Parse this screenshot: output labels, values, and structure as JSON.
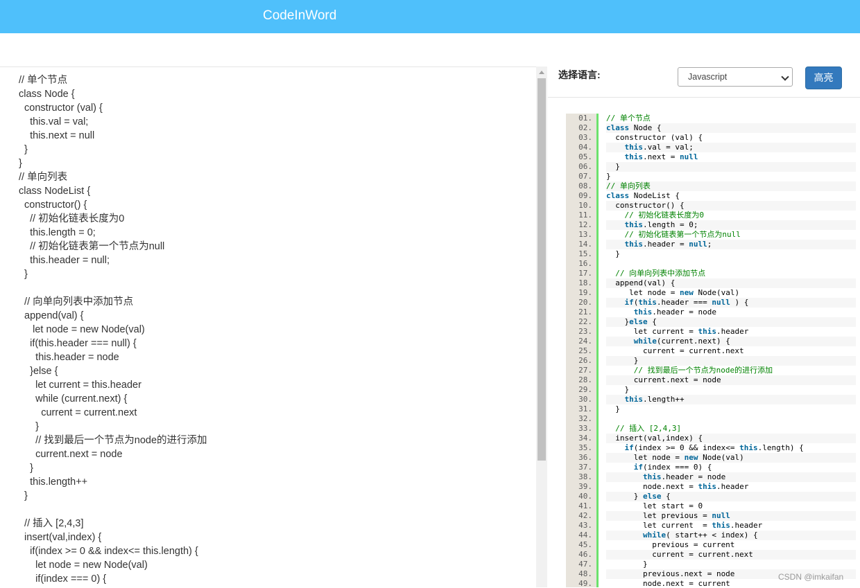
{
  "header": {
    "title": "CodeInWord"
  },
  "left_editor": {
    "lines": [
      "// 单个节点",
      "class Node {",
      "  constructor (val) {",
      "    this.val = val;",
      "    this.next = null",
      "  }",
      "}",
      "// 单向列表",
      "class NodeList {",
      "  constructor() {",
      "    // 初始化链表长度为0",
      "    this.length = 0;",
      "    // 初始化链表第一个节点为null",
      "    this.header = null;",
      "  }",
      "",
      "  // 向单向列表中添加节点",
      "  append(val) {",
      "     let node = new Node(val)",
      "    if(this.header === null) {",
      "      this.header = node",
      "    }else {",
      "      let current = this.header",
      "      while (current.next) {",
      "        current = current.next",
      "      }",
      "      // 找到最后一个节点为node的进行添加",
      "      current.next = node",
      "    }",
      "    this.length++",
      "  }",
      "",
      "  // 插入 [2,4,3]",
      "  insert(val,index) {",
      "    if(index >= 0 && index<= this.length) {",
      "      let node = new Node(val)",
      "      if(index === 0) {"
    ]
  },
  "controls": {
    "language_label": "选择语言:",
    "language_selected": "Javascript",
    "highlight_button": "高亮"
  },
  "highlighted": {
    "lines": [
      {
        "n": "01.",
        "t": [
          [
            "cm",
            "// 单个节点"
          ]
        ]
      },
      {
        "n": "02.",
        "t": [
          [
            "kw",
            "class"
          ],
          [
            "",
            "Node {"
          ]
        ]
      },
      {
        "n": "03.",
        "t": [
          [
            "",
            "  constructor (val) {"
          ]
        ]
      },
      {
        "n": "04.",
        "t": [
          [
            "",
            "    "
          ],
          [
            "kw",
            "this"
          ],
          [
            "",
            ".val = val;"
          ]
        ]
      },
      {
        "n": "05.",
        "t": [
          [
            "",
            "    "
          ],
          [
            "kw",
            "this"
          ],
          [
            "",
            ".next = "
          ],
          [
            "kw",
            "null"
          ]
        ]
      },
      {
        "n": "06.",
        "t": [
          [
            "",
            "  }"
          ]
        ]
      },
      {
        "n": "07.",
        "t": [
          [
            "",
            "}"
          ]
        ]
      },
      {
        "n": "08.",
        "t": [
          [
            "cm",
            "// 单向列表"
          ]
        ]
      },
      {
        "n": "09.",
        "t": [
          [
            "kw",
            "class"
          ],
          [
            "",
            "NodeList {"
          ]
        ]
      },
      {
        "n": "10.",
        "t": [
          [
            "",
            "  constructor() {"
          ]
        ]
      },
      {
        "n": "11.",
        "t": [
          [
            "",
            "    "
          ],
          [
            "cm",
            "// 初始化链表长度为0"
          ]
        ]
      },
      {
        "n": "12.",
        "t": [
          [
            "",
            "    "
          ],
          [
            "kw",
            "this"
          ],
          [
            "",
            ".length = 0;"
          ]
        ]
      },
      {
        "n": "13.",
        "t": [
          [
            "",
            "    "
          ],
          [
            "cm",
            "// 初始化链表第一个节点为null"
          ]
        ]
      },
      {
        "n": "14.",
        "t": [
          [
            "",
            "    "
          ],
          [
            "kw",
            "this"
          ],
          [
            "",
            ".header = "
          ],
          [
            "kw",
            "null"
          ],
          [
            "",
            ";"
          ]
        ]
      },
      {
        "n": "15.",
        "t": [
          [
            "",
            "  }"
          ]
        ]
      },
      {
        "n": "16.",
        "t": [
          [
            "",
            ""
          ]
        ]
      },
      {
        "n": "17.",
        "t": [
          [
            "",
            "  "
          ],
          [
            "cm",
            "// 向单向列表中添加节点"
          ]
        ]
      },
      {
        "n": "18.",
        "t": [
          [
            "",
            "  append(val) {"
          ]
        ]
      },
      {
        "n": "19.",
        "t": [
          [
            "",
            "     let node = "
          ],
          [
            "kw",
            "new"
          ],
          [
            "",
            "Node(val)"
          ]
        ]
      },
      {
        "n": "20.",
        "t": [
          [
            "",
            "    "
          ],
          [
            "kw",
            "if"
          ],
          [
            "",
            "("
          ],
          [
            "kw",
            "this"
          ],
          [
            "",
            ".header === "
          ],
          [
            "kw",
            "null"
          ],
          [
            "",
            ") {"
          ]
        ]
      },
      {
        "n": "21.",
        "t": [
          [
            "",
            "      "
          ],
          [
            "kw",
            "this"
          ],
          [
            "",
            ".header = node"
          ]
        ]
      },
      {
        "n": "22.",
        "t": [
          [
            "",
            "    }"
          ],
          [
            "kw",
            "else"
          ],
          [
            "",
            "{"
          ]
        ]
      },
      {
        "n": "23.",
        "t": [
          [
            "",
            "      let current = "
          ],
          [
            "kw",
            "this"
          ],
          [
            "",
            ".header"
          ]
        ]
      },
      {
        "n": "24.",
        "t": [
          [
            "",
            "      "
          ],
          [
            "kw",
            "while"
          ],
          [
            "",
            "(current.next) {"
          ]
        ]
      },
      {
        "n": "25.",
        "t": [
          [
            "",
            "        current = current.next"
          ]
        ]
      },
      {
        "n": "26.",
        "t": [
          [
            "",
            "      }"
          ]
        ]
      },
      {
        "n": "27.",
        "t": [
          [
            "",
            "      "
          ],
          [
            "cm",
            "// 找到最后一个节点为node的进行添加"
          ]
        ]
      },
      {
        "n": "28.",
        "t": [
          [
            "",
            "      current.next = node"
          ]
        ]
      },
      {
        "n": "29.",
        "t": [
          [
            "",
            "    }"
          ]
        ]
      },
      {
        "n": "30.",
        "t": [
          [
            "",
            "    "
          ],
          [
            "kw",
            "this"
          ],
          [
            "",
            ".length++"
          ]
        ]
      },
      {
        "n": "31.",
        "t": [
          [
            "",
            "  }"
          ]
        ]
      },
      {
        "n": "32.",
        "t": [
          [
            "",
            ""
          ]
        ]
      },
      {
        "n": "33.",
        "t": [
          [
            "",
            "  "
          ],
          [
            "cm",
            "// 插入 [2,4,3]"
          ]
        ]
      },
      {
        "n": "34.",
        "t": [
          [
            "",
            "  insert(val,index) {"
          ]
        ]
      },
      {
        "n": "35.",
        "t": [
          [
            "",
            "    "
          ],
          [
            "kw",
            "if"
          ],
          [
            "",
            "(index >= 0 && index<= "
          ],
          [
            "kw",
            "this"
          ],
          [
            "",
            ".length) {"
          ]
        ]
      },
      {
        "n": "36.",
        "t": [
          [
            "",
            "      let node = "
          ],
          [
            "kw",
            "new"
          ],
          [
            "",
            "Node(val)"
          ]
        ]
      },
      {
        "n": "37.",
        "t": [
          [
            "",
            "      "
          ],
          [
            "kw",
            "if"
          ],
          [
            "",
            "(index === 0) {"
          ]
        ]
      },
      {
        "n": "38.",
        "t": [
          [
            "",
            "        "
          ],
          [
            "kw",
            "this"
          ],
          [
            "",
            ".header = node"
          ]
        ]
      },
      {
        "n": "39.",
        "t": [
          [
            "",
            "        node.next = "
          ],
          [
            "kw",
            "this"
          ],
          [
            "",
            ".header"
          ]
        ]
      },
      {
        "n": "40.",
        "t": [
          [
            "",
            "      } "
          ],
          [
            "kw",
            "else"
          ],
          [
            "",
            "{"
          ]
        ]
      },
      {
        "n": "41.",
        "t": [
          [
            "",
            "        let start = 0"
          ]
        ]
      },
      {
        "n": "42.",
        "t": [
          [
            "",
            "        let previous = "
          ],
          [
            "kw",
            "null"
          ]
        ]
      },
      {
        "n": "43.",
        "t": [
          [
            "",
            "        let current  = "
          ],
          [
            "kw",
            "this"
          ],
          [
            "",
            ".header"
          ]
        ]
      },
      {
        "n": "44.",
        "t": [
          [
            "",
            "        "
          ],
          [
            "kw",
            "while"
          ],
          [
            "",
            "( start++ < index) {"
          ]
        ]
      },
      {
        "n": "45.",
        "t": [
          [
            "",
            "          previous = current"
          ]
        ]
      },
      {
        "n": "46.",
        "t": [
          [
            "",
            "          current = current.next"
          ]
        ]
      },
      {
        "n": "47.",
        "t": [
          [
            "",
            "        }"
          ]
        ]
      },
      {
        "n": "48.",
        "t": [
          [
            "",
            "        previous.next = node"
          ]
        ]
      },
      {
        "n": "49.",
        "t": [
          [
            "",
            "        node.next = current"
          ]
        ]
      }
    ]
  },
  "watermark": "CSDN @imkaifan",
  "colors": {
    "header_bg": "#4fc0fb",
    "button_bg": "#3379bd",
    "keyword": "#006699",
    "comment": "#008200",
    "gutter_accent": "#6ce26c"
  }
}
